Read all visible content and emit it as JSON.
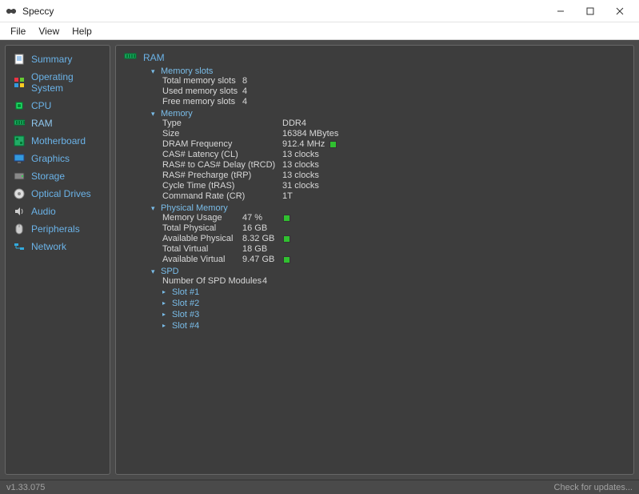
{
  "window": {
    "title": "Speccy"
  },
  "menu": {
    "file": "File",
    "view": "View",
    "help": "Help"
  },
  "nav": {
    "summary": "Summary",
    "os": "Operating System",
    "cpu": "CPU",
    "ram": "RAM",
    "motherboard": "Motherboard",
    "graphics": "Graphics",
    "storage": "Storage",
    "optical": "Optical Drives",
    "audio": "Audio",
    "peripherals": "Peripherals",
    "network": "Network"
  },
  "content": {
    "title": "RAM",
    "memorySlots": {
      "title": "Memory slots",
      "total_k": "Total memory slots",
      "total_v": "8",
      "used_k": "Used memory slots",
      "used_v": "4",
      "free_k": "Free memory slots",
      "free_v": "4"
    },
    "memory": {
      "title": "Memory",
      "type_k": "Type",
      "type_v": "DDR4",
      "size_k": "Size",
      "size_v": "16384 MBytes",
      "dram_k": "DRAM Frequency",
      "dram_v": "912.4 MHz",
      "cl_k": "CAS# Latency (CL)",
      "cl_v": "13 clocks",
      "rcd_k": "RAS# to CAS# Delay (tRCD)",
      "rcd_v": "13 clocks",
      "rp_k": "RAS# Precharge (tRP)",
      "rp_v": "13 clocks",
      "ras_k": "Cycle Time (tRAS)",
      "ras_v": "31 clocks",
      "cr_k": "Command Rate (CR)",
      "cr_v": "1T"
    },
    "physical": {
      "title": "Physical Memory",
      "usage_k": "Memory Usage",
      "usage_v": "47 %",
      "tphys_k": "Total Physical",
      "tphys_v": "16 GB",
      "aphys_k": "Available Physical",
      "aphys_v": "8.32 GB",
      "tvirt_k": "Total Virtual",
      "tvirt_v": "18 GB",
      "avirt_k": "Available Virtual",
      "avirt_v": "9.47 GB"
    },
    "spd": {
      "title": "SPD",
      "num_k": "Number Of SPD Modules",
      "num_v": "4",
      "slot1": "Slot #1",
      "slot2": "Slot #2",
      "slot3": "Slot #3",
      "slot4": "Slot #4"
    }
  },
  "status": {
    "version": "v1.33.075",
    "updates": "Check for updates..."
  }
}
